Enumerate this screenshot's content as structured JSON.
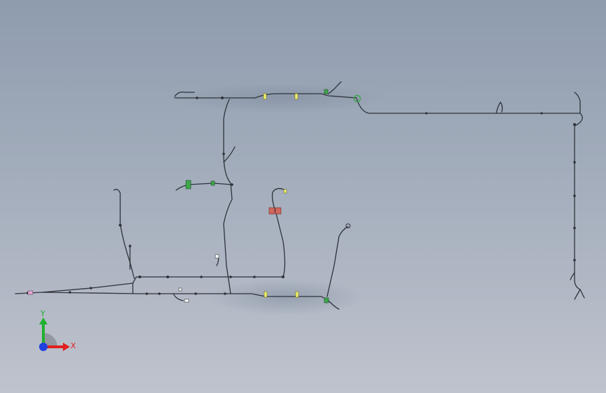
{
  "viewport": {
    "background_top": "#8f9cae",
    "background_bottom": "#bfc3cd"
  },
  "harness": {
    "wire_color": "#2e333a",
    "connector_colors": {
      "yellow": "#f0f06a",
      "green": "#3ea64b",
      "red": "#d0675f",
      "light_green": "#c9f08a",
      "pink": "#e6a9d6"
    }
  },
  "triad": {
    "x_label": "X",
    "y_label": "Y",
    "x_color": "#e02020",
    "y_color": "#20b030",
    "z_color": "#2040e0"
  }
}
